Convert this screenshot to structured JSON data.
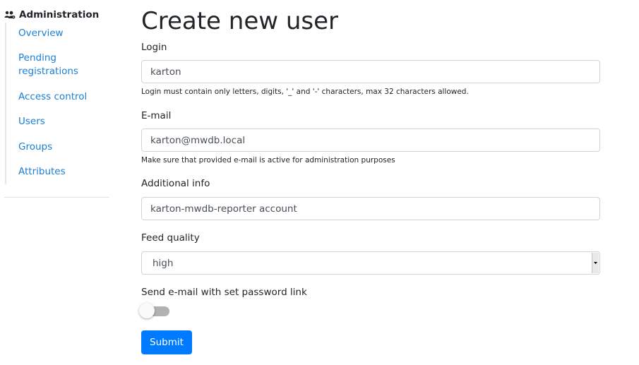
{
  "sidebar": {
    "header": "Administration",
    "header_icon": "users-cog-icon",
    "items": [
      {
        "label": "Overview"
      },
      {
        "label": "Pending registrations"
      },
      {
        "label": "Access control"
      },
      {
        "label": "Users"
      },
      {
        "label": "Groups"
      },
      {
        "label": "Attributes"
      }
    ]
  },
  "form": {
    "title": "Create new user",
    "login": {
      "label": "Login",
      "value": "karton",
      "help": "Login must contain only letters, digits, '_' and '-' characters, max 32 characters allowed."
    },
    "email": {
      "label": "E-mail",
      "value": "karton@mwdb.local",
      "help": "Make sure that provided e-mail is active for administration purposes"
    },
    "additional_info": {
      "label": "Additional info",
      "value": "karton-mwdb-reporter account"
    },
    "feed_quality": {
      "label": "Feed quality",
      "value": "high"
    },
    "send_email": {
      "label": "Send e-mail with set password link",
      "enabled": false
    },
    "submit_label": "Submit"
  },
  "colors": {
    "link": "#1a7fd6",
    "primary": "#007bff",
    "toggle_off": "#b2b2b2"
  }
}
